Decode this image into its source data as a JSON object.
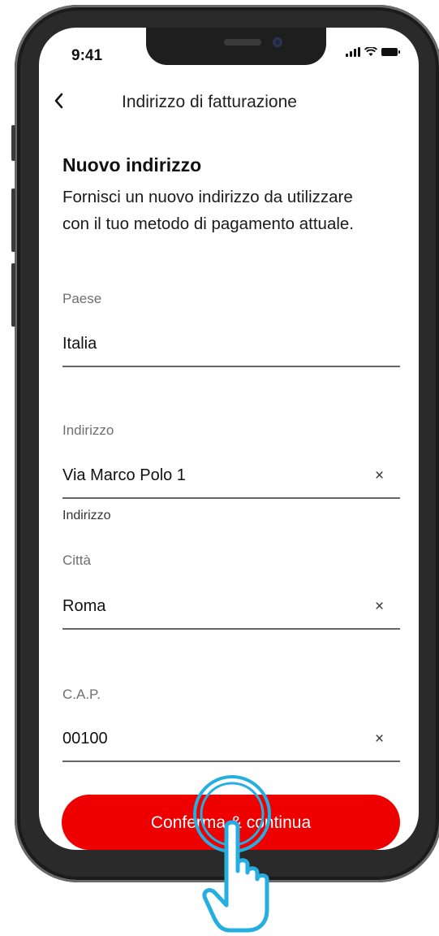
{
  "status_bar": {
    "time": "9:41"
  },
  "header": {
    "title": "Indirizzo di fatturazione",
    "back_icon": "chevron-left-icon"
  },
  "section": {
    "title": "Nuovo indirizzo",
    "description": "Fornisci un nuovo indirizzo da utilizzare con il tuo metodo di pagamento attuale."
  },
  "fields": {
    "country": {
      "label": "Paese",
      "value": "Italia"
    },
    "address": {
      "label": "Indirizzo",
      "value": "Via Marco Polo 1",
      "helper": "Indirizzo",
      "clear": "×"
    },
    "city": {
      "label": "Città",
      "value": "Roma",
      "clear": "×"
    },
    "zip": {
      "label": "C.A.P.",
      "value": "00100",
      "clear": "×"
    }
  },
  "cta": {
    "label": "Conferma & continua"
  },
  "colors": {
    "accent": "#ef0000",
    "tap_indicator": "#25aee0"
  }
}
